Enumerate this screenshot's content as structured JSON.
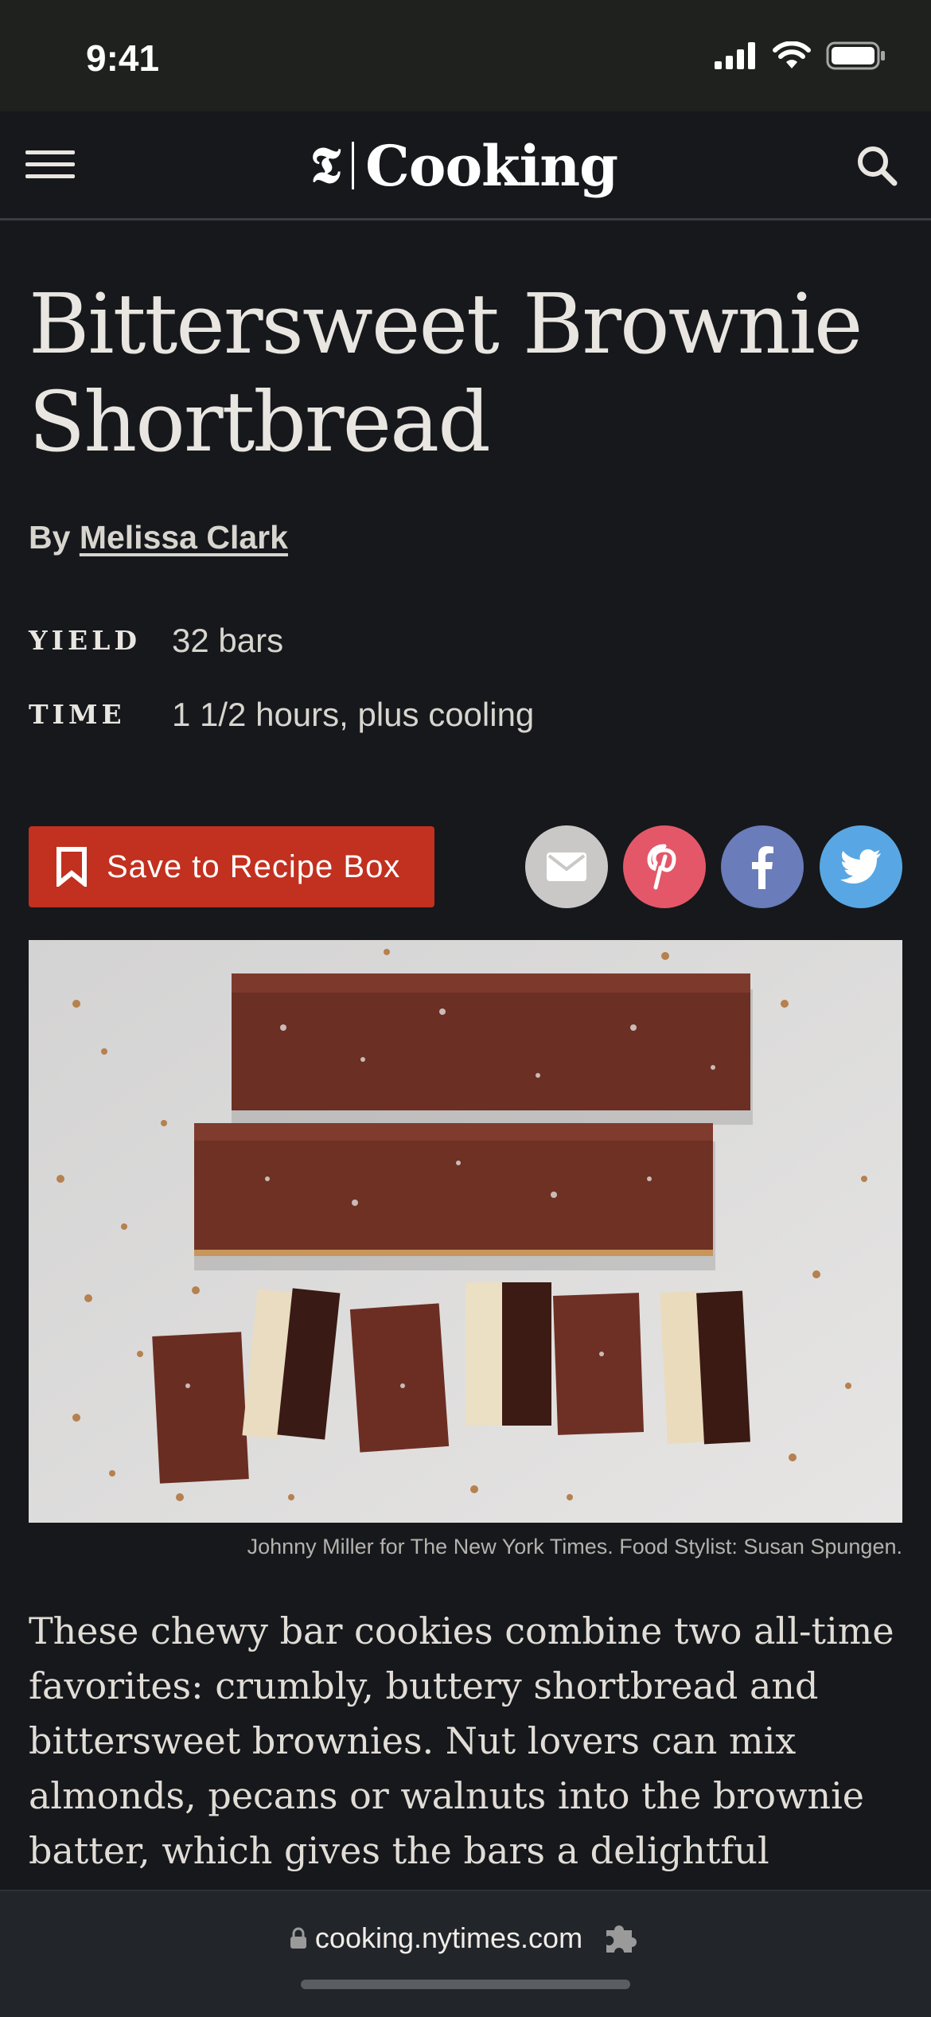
{
  "status": {
    "time": "9:41"
  },
  "header": {
    "logo_mark": "𝕿",
    "logo_word": "Cooking"
  },
  "recipe": {
    "title": "Bittersweet Brownie Shortbread",
    "by_prefix": "By",
    "author": "Melissa Clark",
    "yield_label": "YIELD",
    "yield_value": "32 bars",
    "time_label": "TIME",
    "time_value": "1 1/2 hours, plus cooling",
    "save_label": "Save to Recipe Box",
    "photo_credit": "Johnny Miller for The New York Times. Food Stylist: Susan Spungen.",
    "description": "These chewy bar cookies combine two all-time favorites: crumbly, buttery shortbread and bittersweet brownies. Nut lovers can mix almonds, pecans or walnuts into the brownie batter, which gives the bars a delightful crunch."
  },
  "browser": {
    "url": "cooking.nytimes.com"
  },
  "colors": {
    "background": "#16181c",
    "save_button": "#c2301f",
    "email": "#c9c8c6",
    "pinterest": "#e45769",
    "facebook": "#6a7cba",
    "twitter": "#58a7e4"
  },
  "icons": [
    "signal-icon",
    "wifi-icon",
    "battery-icon",
    "menu-icon",
    "search-icon",
    "bookmark-icon",
    "email-icon",
    "pinterest-icon",
    "facebook-icon",
    "twitter-icon",
    "lock-icon",
    "puzzle-icon"
  ]
}
